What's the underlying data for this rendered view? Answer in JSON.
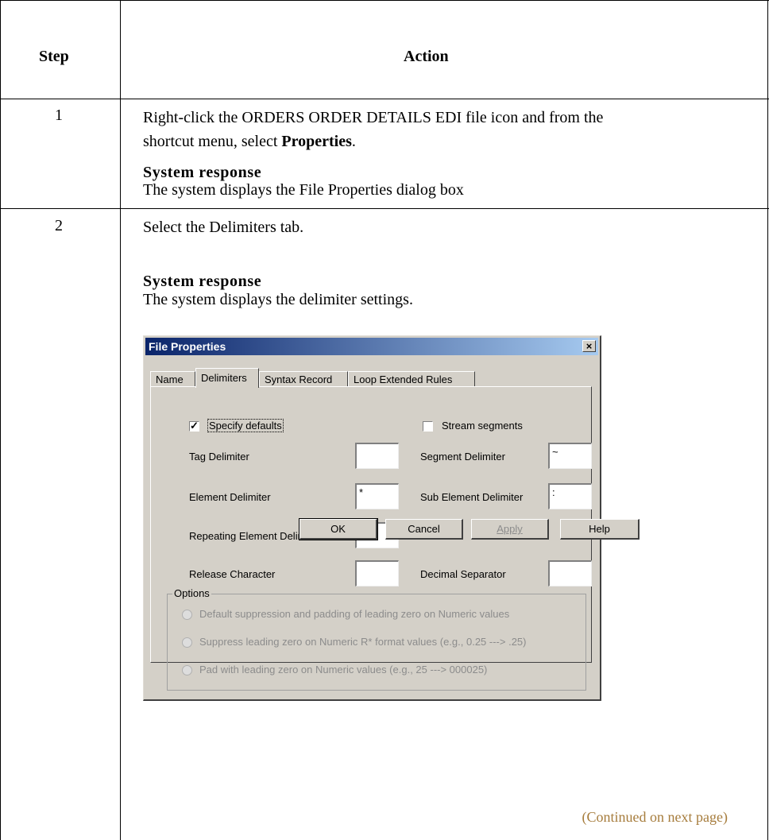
{
  "table": {
    "header_step": "Step",
    "header_action": "Action"
  },
  "rows": [
    {
      "step": "1",
      "line1": "Right-click the ORDERS ORDER DETAILS EDI file icon and from the",
      "line2_prefix": "shortcut menu, select ",
      "line2_bold": "Properties",
      "line2_suffix": ".",
      "response_heading": "System response",
      "response_text": "The system displays the File Properties dialog box"
    },
    {
      "step": "2",
      "line1": "Select the Delimiters tab.",
      "response_heading": "System response",
      "response_text": "The system displays the delimiter settings."
    }
  ],
  "dialog": {
    "title": "File Properties",
    "close_glyph": "×",
    "tabs": [
      "Name",
      "Delimiters",
      "Syntax Record",
      "Loop Extended Rules"
    ],
    "active_tab": "Delimiters",
    "specify_defaults": {
      "label": "Specify defaults",
      "checked": true,
      "mark": "✓"
    },
    "stream_segments": {
      "label": "Stream segments",
      "checked": false
    },
    "fields": {
      "tag_delimiter": {
        "label": "Tag Delimiter",
        "value": ""
      },
      "segment_delimiter": {
        "label": "Segment Delimiter",
        "value": "~"
      },
      "element_delimiter": {
        "label": "Element Delimiter",
        "value": "*"
      },
      "sub_element_delimiter": {
        "label": "Sub Element Delimiter",
        "value": ":"
      },
      "repeating_element_delimiter": {
        "label": "Repeating Element Delimiter",
        "value": ""
      },
      "release_character": {
        "label": "Release Character",
        "value": ""
      },
      "decimal_separator": {
        "label": "Decimal Separator",
        "value": ""
      }
    },
    "options": {
      "label": "Options",
      "radios": [
        "Default suppression and padding of leading zero on Numeric values",
        "Suppress leading zero on Numeric R* format values (e.g., 0.25 ---> .25)",
        "Pad with leading zero on Numeric values (e.g., 25 ---> 000025)"
      ]
    },
    "buttons": {
      "ok": "OK",
      "cancel": "Cancel",
      "apply": "Apply",
      "help": "Help"
    }
  },
  "footer": {
    "continued": "(Continued on next page)"
  }
}
